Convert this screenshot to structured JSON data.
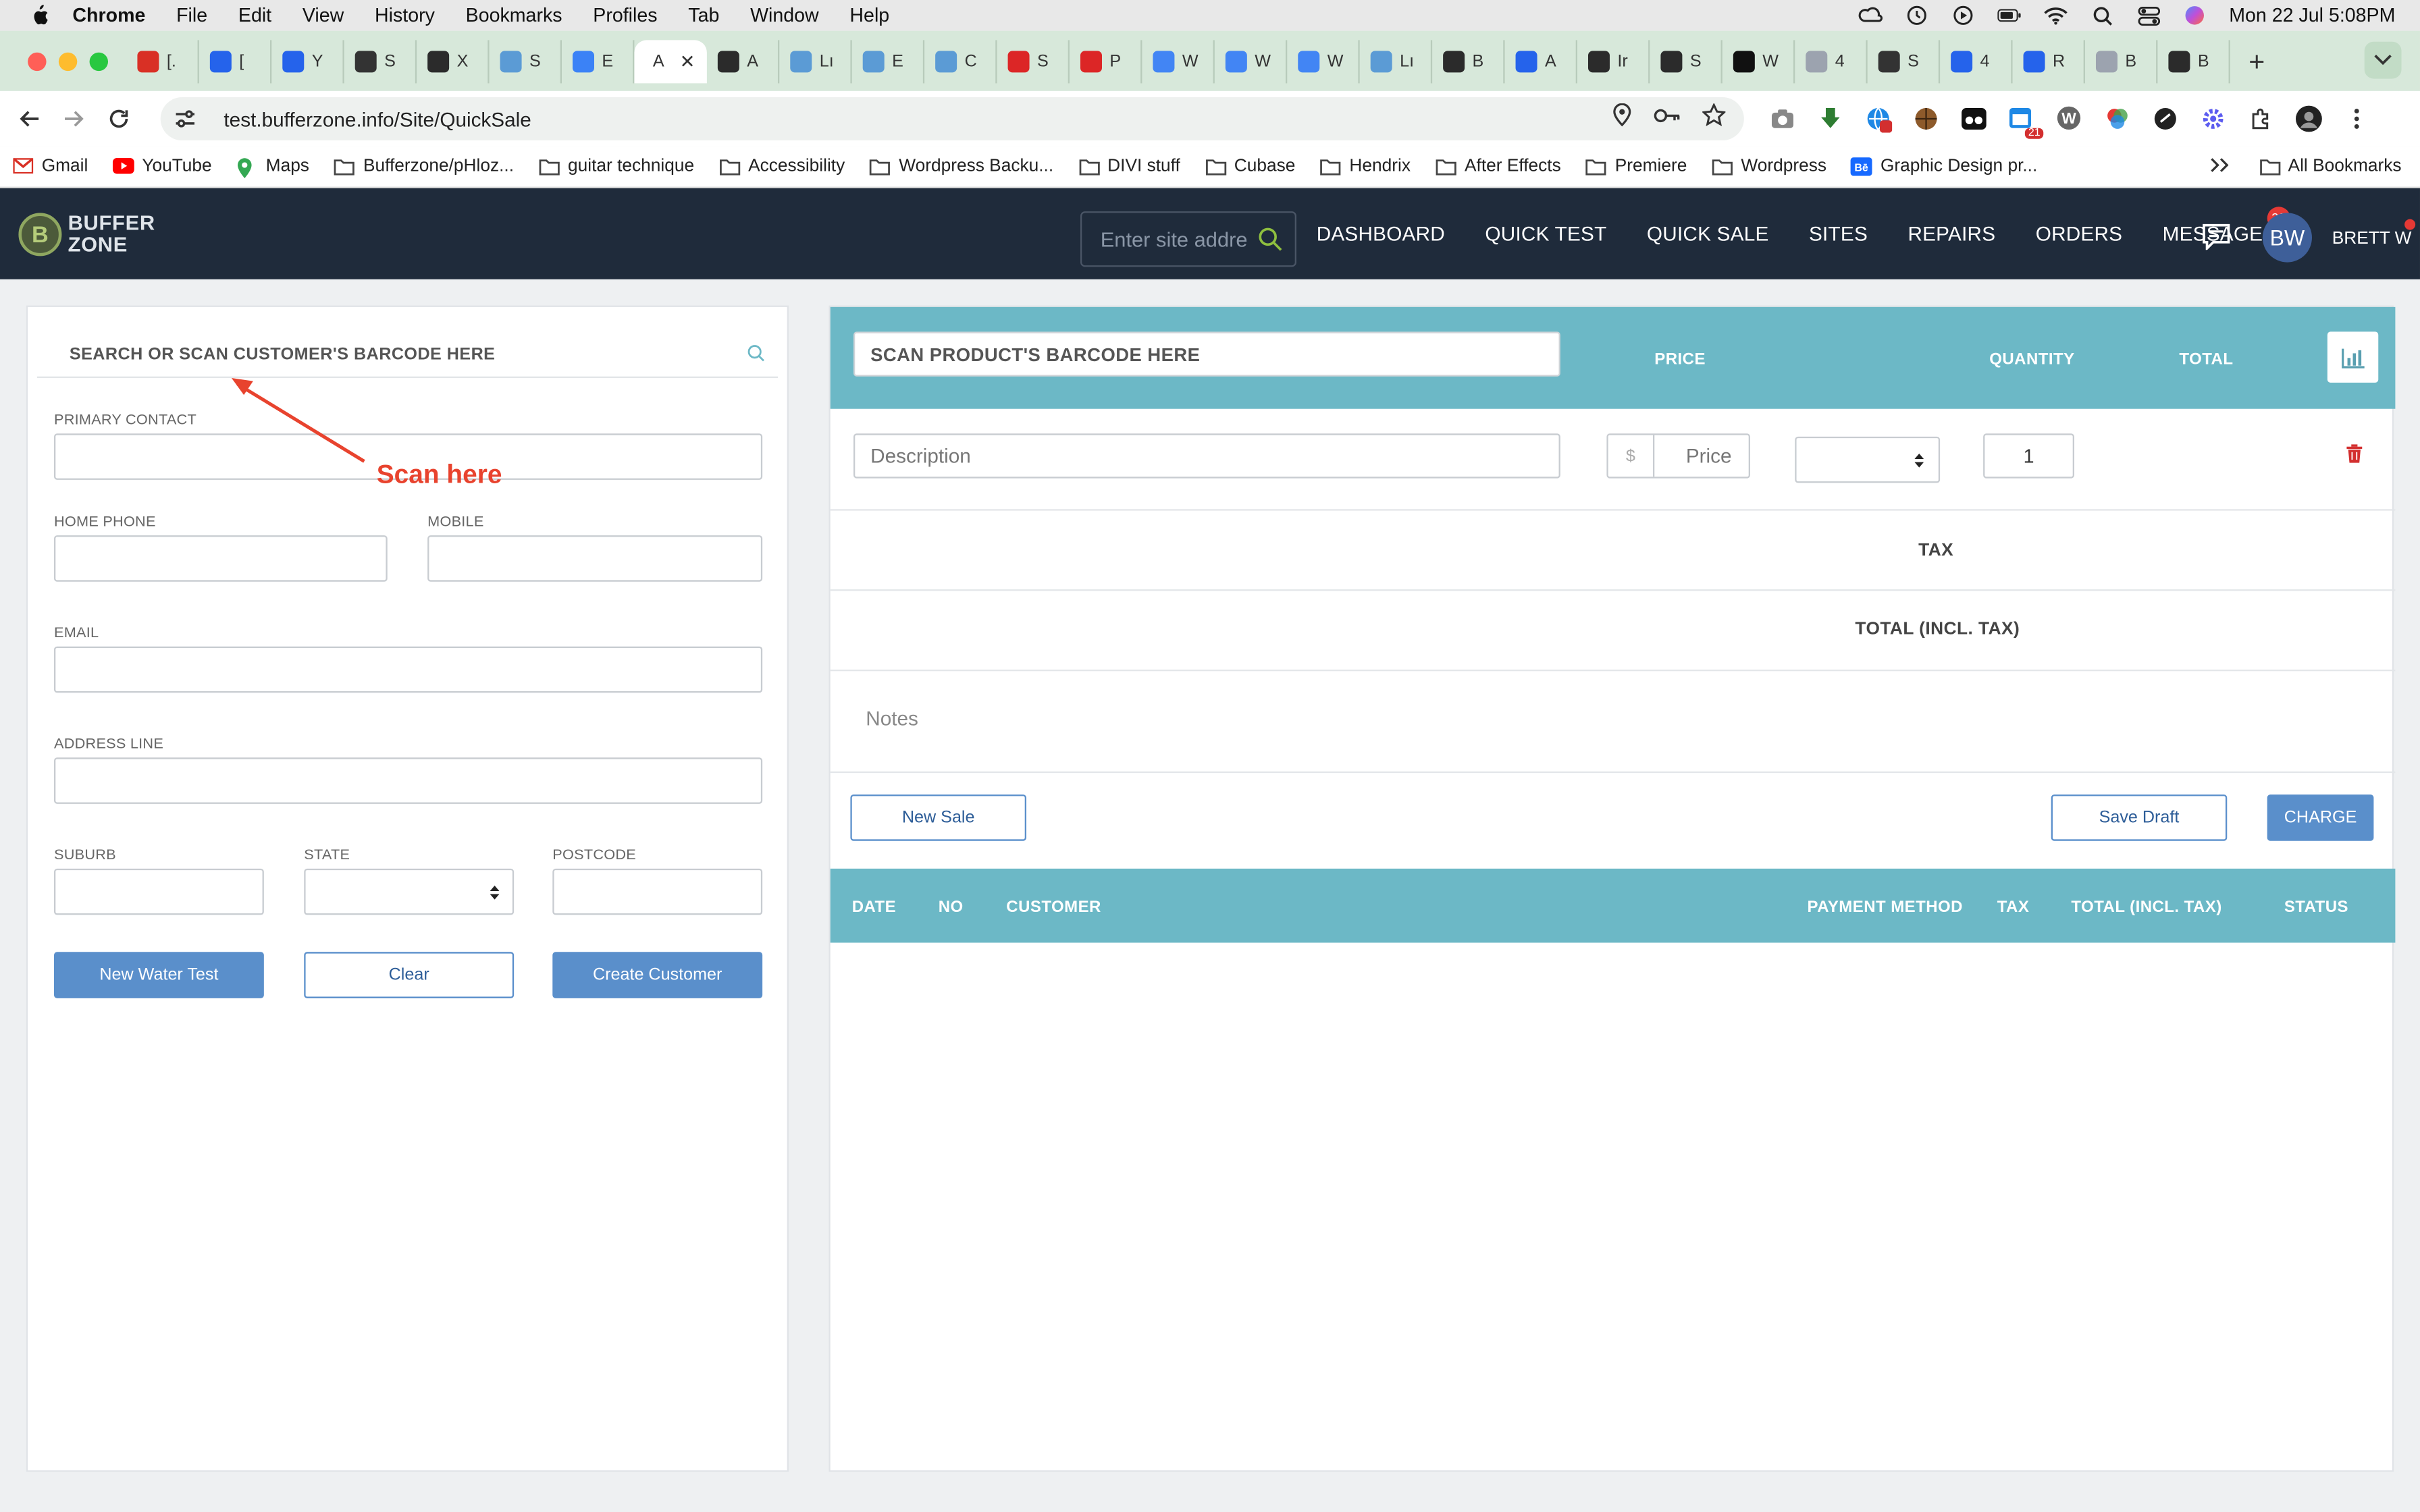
{
  "os_menubar": {
    "app_name": "Chrome",
    "menus": [
      "File",
      "Edit",
      "View",
      "History",
      "Bookmarks",
      "Profiles",
      "Tab",
      "Window",
      "Help"
    ],
    "clock": "Mon 22 Jul  5:08PM"
  },
  "browser": {
    "tabs": [
      {
        "label": "[.",
        "color": "#d93025"
      },
      {
        "label": "[",
        "color": "#2563eb"
      },
      {
        "label": "Y",
        "color": "#2563eb"
      },
      {
        "label": "S",
        "color": "#333333"
      },
      {
        "label": "X",
        "color": "#2b2b2b"
      },
      {
        "label": "S",
        "color": "#5b9bd5"
      },
      {
        "label": "E",
        "color": "#3b82f6"
      },
      {
        "label": "A",
        "color": "#ffffff",
        "active": true
      },
      {
        "label": "A",
        "color": "#2b2b2b"
      },
      {
        "label": "Lı",
        "color": "#5b9bd5"
      },
      {
        "label": "E",
        "color": "#5b9bd5"
      },
      {
        "label": "C",
        "color": "#5b9bd5"
      },
      {
        "label": "S",
        "color": "#dc2626"
      },
      {
        "label": "P",
        "color": "#dc2626"
      },
      {
        "label": "W",
        "color": "#4285f4"
      },
      {
        "label": "W",
        "color": "#4285f4"
      },
      {
        "label": "W",
        "color": "#4285f4"
      },
      {
        "label": "Lı",
        "color": "#5b9bd5"
      },
      {
        "label": "B",
        "color": "#2b2b2b"
      },
      {
        "label": "A",
        "color": "#2563eb"
      },
      {
        "label": "Ir",
        "color": "#2b2b2b"
      },
      {
        "label": "S",
        "color": "#2b2b2b"
      },
      {
        "label": "W",
        "color": "#111111"
      },
      {
        "label": "4",
        "color": "#9ca3af"
      },
      {
        "label": "S",
        "color": "#333333"
      },
      {
        "label": "4",
        "color": "#2563eb"
      },
      {
        "label": "R",
        "color": "#2563eb"
      },
      {
        "label": "B",
        "color": "#9ca3af"
      },
      {
        "label": "B",
        "color": "#2b2b2b"
      }
    ],
    "url": "test.bufferzone.info/Site/QuickSale",
    "bookmarks": [
      "Gmail",
      "YouTube",
      "Maps",
      "Bufferzone/pHloz...",
      "guitar technique",
      "Accessibility",
      "Wordpress Backu...",
      "DIVI stuff",
      "Cubase",
      "Hendrix",
      "After Effects",
      "Premiere",
      "Wordpress",
      "Graphic Design pr..."
    ],
    "all_bookmarks": "All Bookmarks",
    "ext_badge": "21"
  },
  "app": {
    "logo_line1": "BUFFER",
    "logo_line2": "ZONE",
    "logo_mark": "B",
    "site_search_placeholder": "Enter site addre",
    "nav": [
      "DASHBOARD",
      "QUICK TEST",
      "QUICK SALE",
      "SITES",
      "REPAIRS",
      "ORDERS",
      "MESSAGES"
    ],
    "messages_badge": "30",
    "avatar_initials": "BW",
    "user_name": "BRETT W",
    "colors": {
      "header_bg": "#1f2b3b",
      "teal": "#6cb8c6",
      "primary_btn": "#5a8fcb",
      "annotation": "#e8432e"
    }
  },
  "customer": {
    "search_placeholder": "SEARCH OR SCAN CUSTOMER'S BARCODE HERE",
    "annotation": "Scan here",
    "labels": {
      "primary_contact": "PRIMARY CONTACT",
      "home_phone": "HOME PHONE",
      "mobile": "MOBILE",
      "email": "EMAIL",
      "address_line": "ADDRESS LINE",
      "suburb": "SUBURB",
      "state": "STATE",
      "postcode": "POSTCODE"
    },
    "values": {
      "primary_contact": "",
      "home_phone": "",
      "mobile": "",
      "email": "",
      "address_line": "",
      "suburb": "",
      "state": "",
      "postcode": ""
    },
    "buttons": {
      "new_water_test": "New Water Test",
      "clear": "Clear",
      "create_customer": "Create Customer"
    }
  },
  "sale": {
    "scan_placeholder": "SCAN PRODUCT'S BARCODE HERE",
    "columns": {
      "price": "PRICE",
      "quantity": "QUANTITY",
      "total": "TOTAL"
    },
    "line": {
      "description_placeholder": "Description",
      "currency": "$",
      "price_placeholder": "Price",
      "quantity": "1"
    },
    "tax_label": "TAX",
    "total_label": "TOTAL (INCL. TAX)",
    "notes_placeholder": "Notes",
    "buttons": {
      "new_sale": "New Sale",
      "save_draft": "Save Draft",
      "charge": "CHARGE"
    },
    "history_columns": [
      "DATE",
      "NO",
      "CUSTOMER",
      "PAYMENT METHOD",
      "TAX",
      "TOTAL (INCL. TAX)",
      "STATUS"
    ],
    "history_rows": []
  }
}
